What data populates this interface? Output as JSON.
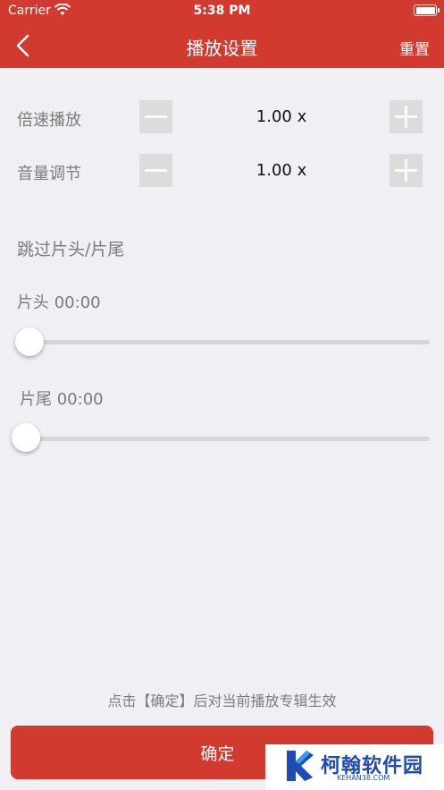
{
  "status_bar": {
    "carrier": "Carrier",
    "time": "5:38 PM"
  },
  "nav": {
    "title": "播放设置",
    "reset_label": "重置"
  },
  "speed": {
    "label": "倍速播放",
    "value": "1.00 x"
  },
  "volume": {
    "label": "音量调节",
    "value": "1.00 x"
  },
  "skip": {
    "section_title": "跳过片头/片尾",
    "intro_label": "片头 00:00",
    "intro_value": 0,
    "outro_label": "片尾 00:00",
    "outro_value": 0
  },
  "footer": {
    "hint": "点击【确定】后对当前播放专辑生效",
    "confirm_label": "确定"
  },
  "watermark": {
    "name": "柯翰软件园",
    "site": "KEHAN38.COM"
  },
  "colors": {
    "brand": "#d23a30",
    "background": "#efeff4",
    "watermark": "#1f4bb5"
  }
}
